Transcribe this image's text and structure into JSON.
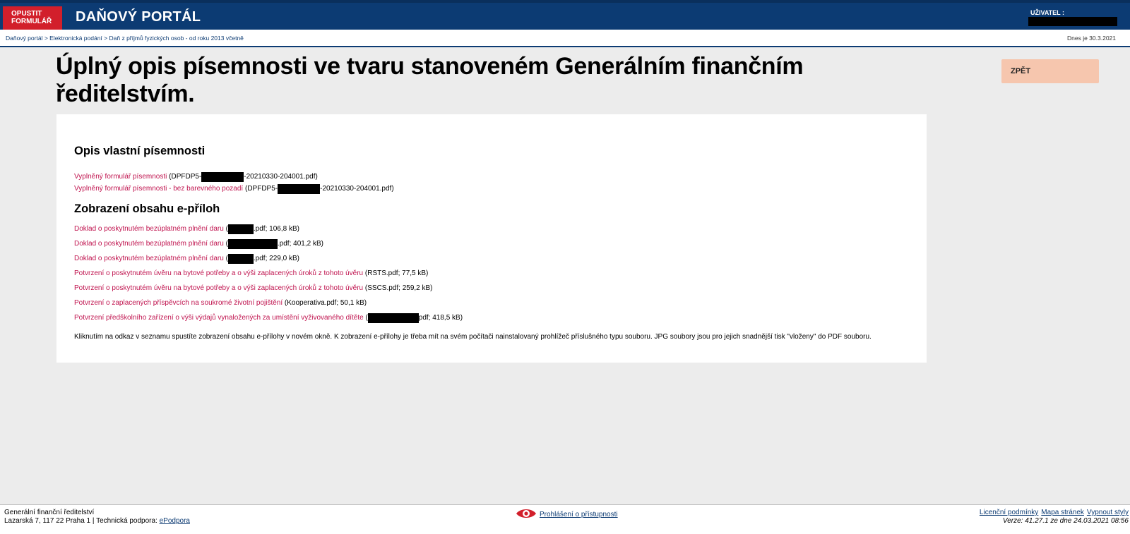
{
  "header": {
    "exit_line1": "OPUSTIT",
    "exit_line2": "FORMULÁŘ",
    "portal_title": "DAŇOVÝ PORTÁL",
    "user_label": "UŽIVATEL :"
  },
  "breadcrumb": {
    "items": [
      "Daňový portál",
      "Elektronická podání",
      "Daň z příjmů fyzických osob - od roku 2013 včetně"
    ],
    "separator": " > ",
    "date_text": "Dnes je 30.3.2021"
  },
  "page": {
    "title": "Úplný opis písemnosti ve tvaru stanoveném Generálním finančním ředitelstvím.",
    "back_label": "ZPĚT"
  },
  "own_doc": {
    "heading": "Opis vlastní písemnosti",
    "items": [
      {
        "link": "Vyplněný formulář písemnosti",
        "pre": " (DPFDP5-",
        "post": "-20210330-204001.pdf)"
      },
      {
        "link": "Vyplněný formulář písemnosti  - bez barevného pozadí",
        "pre": " (DPFDP5-",
        "post": "-20210330-204001.pdf)"
      }
    ]
  },
  "attachments": {
    "heading": "Zobrazení obsahu e-příloh",
    "items": [
      {
        "link": "Doklad o poskytnutém bezúplatném plnění daru",
        "pre": " (",
        "post": ".pdf; 106,8 kB)"
      },
      {
        "link": "Doklad o poskytnutém bezúplatném plnění daru",
        "pre": " (",
        "post": ".pdf; 401,2 kB)"
      },
      {
        "link": "Doklad o poskytnutém bezúplatném plnění daru",
        "pre": " (",
        "post": ".pdf; 229,0 kB)"
      },
      {
        "link": "Potvrzení o poskytnutém úvěru na bytové potřeby a o výši zaplacených úroků z tohoto úvěru",
        "pre": " (RSTS.pdf; 77,5 kB)",
        "post": ""
      },
      {
        "link": "Potvrzení o poskytnutém úvěru na bytové potřeby a o výši zaplacených úroků z tohoto úvěru",
        "pre": " (SSCS.pdf; 259,2 kB)",
        "post": ""
      },
      {
        "link": "Potvrzení o zaplacených příspěvcích na soukromé životní pojištění",
        "pre": " (Kooperativa.pdf; 50,1 kB)",
        "post": ""
      },
      {
        "link": "Potvrzení předškolního zařízení o výši výdajů vynaložených za umístění vyživovaného dítěte",
        "pre": " (",
        "post": "pdf; 418,5 kB)"
      }
    ],
    "note": "Kliknutím na odkaz v seznamu spustíte zobrazení obsahu e-přílohy v novém okně. K zobrazení e-přílohy je třeba mít na svém počítači nainstalovaný prohlížeč příslušného typu souboru. JPG soubory jsou pro jejich snadnější tisk \"vloženy\" do PDF souboru."
  },
  "footer": {
    "org_name": "Generální finanční ředitelství",
    "org_addr": "Lazarská 7, 117 22 Praha 1 | Technická podpora: ",
    "support_link": "ePodpora",
    "accessibility": "Prohlášení o přístupnosti",
    "links": [
      "Licenční podmínky",
      "Mapa stránek",
      "Vypnout styly"
    ],
    "version": "Verze: 41.27.1 ze dne 24.03.2021 08:56"
  },
  "colors": {
    "header_blue": "#0c3b73",
    "exit_red": "#d21f2b",
    "link_red": "#c0144f",
    "back_button": "#f6c6ae"
  },
  "icons": {
    "accessibility": "eye-icon"
  }
}
